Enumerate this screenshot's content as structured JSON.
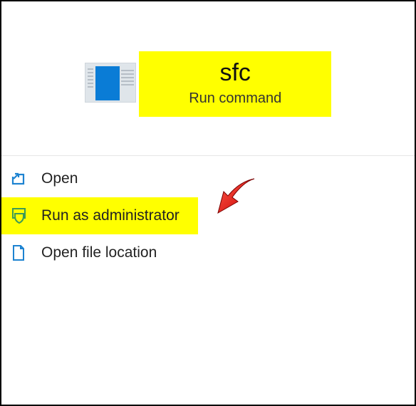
{
  "result": {
    "title": "sfc",
    "subtitle": "Run command"
  },
  "actions": {
    "open": "Open",
    "run_as_admin": "Run as administrator",
    "open_file_location": "Open file location"
  },
  "colors": {
    "highlight": "#ffff00",
    "icon_blue": "#1d83d1",
    "icon_green": "#3e9b55"
  },
  "highlighted_action": "run_as_admin"
}
